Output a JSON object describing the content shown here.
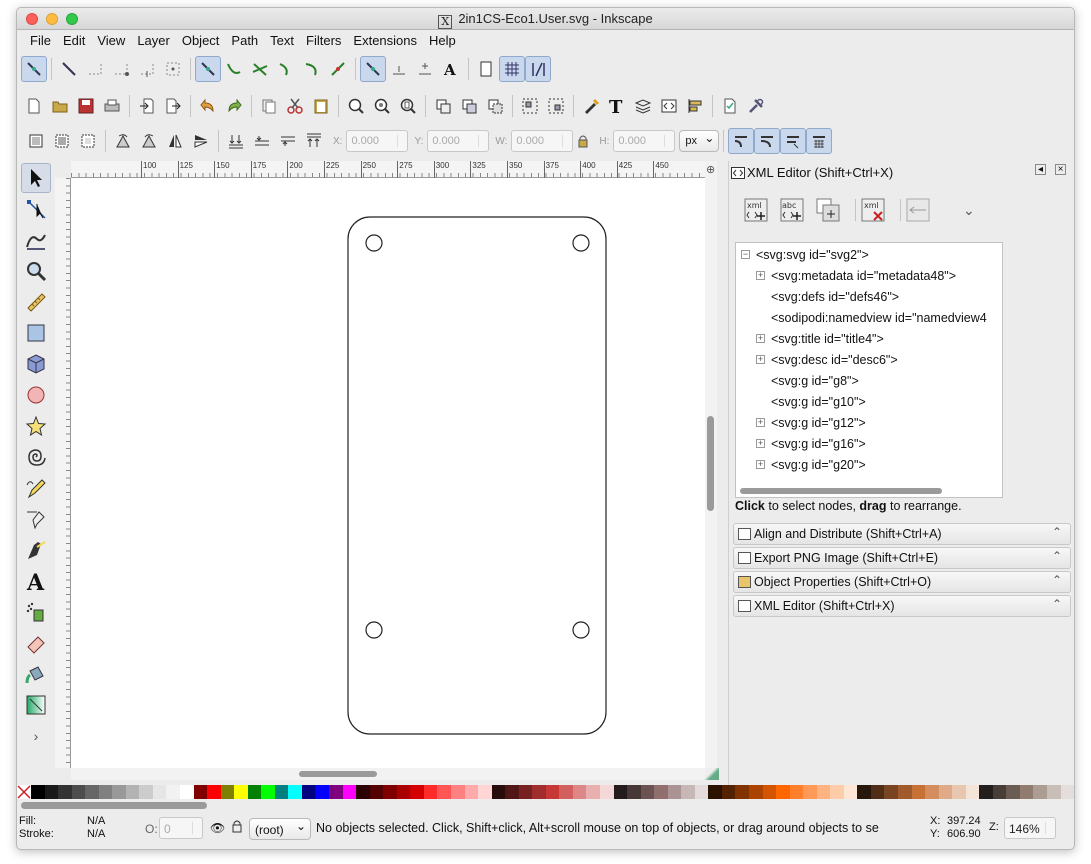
{
  "window": {
    "title": "2in1CS-Eco1.User.svg - Inkscape",
    "title_icon": "X"
  },
  "menubar": [
    "File",
    "Edit",
    "View",
    "Layer",
    "Object",
    "Path",
    "Text",
    "Filters",
    "Extensions",
    "Help"
  ],
  "select_toolbar": {
    "x_label": "X:",
    "x_value": "0.000",
    "y_label": "Y:",
    "y_value": "0.000",
    "w_label": "W:",
    "w_value": "0.000",
    "h_label": "H:",
    "h_value": "0.000",
    "unit": "px"
  },
  "ruler": {
    "top_ticks": [
      "100",
      "125",
      "150",
      "175",
      "200",
      "225",
      "250",
      "275",
      "300",
      "325",
      "350",
      "375",
      "400",
      "425",
      "450"
    ]
  },
  "xml_editor": {
    "title": "XML Editor (Shift+Ctrl+X)",
    "toolbar": {
      "new_element_icon": "xml",
      "new_text_icon": "abc",
      "delete_icon": "xml"
    },
    "nodes": [
      {
        "label": "<svg:svg id=\"svg2\">",
        "expander": "−",
        "level": 0
      },
      {
        "label": "<svg:metadata id=\"metadata48\">",
        "expander": "+",
        "level": 1
      },
      {
        "label": "<svg:defs id=\"defs46\">",
        "expander": "",
        "level": 1
      },
      {
        "label": "<sodipodi:namedview id=\"namedview4",
        "expander": "",
        "level": 1
      },
      {
        "label": "<svg:title id=\"title4\">",
        "expander": "+",
        "level": 1
      },
      {
        "label": "<svg:desc id=\"desc6\">",
        "expander": "+",
        "level": 1
      },
      {
        "label": "<svg:g id=\"g8\">",
        "expander": "",
        "level": 1
      },
      {
        "label": "<svg:g id=\"g10\">",
        "expander": "",
        "level": 1
      },
      {
        "label": "<svg:g id=\"g12\">",
        "expander": "+",
        "level": 1
      },
      {
        "label": "<svg:g id=\"g16\">",
        "expander": "+",
        "level": 1
      },
      {
        "label": "<svg:g id=\"g20\">",
        "expander": "+",
        "level": 1
      }
    ],
    "hint_bold1": "Click",
    "hint_text1": " to select nodes, ",
    "hint_bold2": "drag",
    "hint_text2": " to rearrange."
  },
  "dock_panels": [
    "Align and Distribute (Shift+Ctrl+A)",
    "Export PNG Image (Shift+Ctrl+E)",
    "Object Properties (Shift+Ctrl+O)",
    "XML Editor (Shift+Ctrl+X)"
  ],
  "palette": [
    "#000000",
    "#1a1a1a",
    "#333333",
    "#4d4d4d",
    "#666666",
    "#808080",
    "#999999",
    "#b3b3b3",
    "#cccccc",
    "#e6e6e6",
    "#f2f2f2",
    "#ffffff",
    "#800000",
    "#ff0000",
    "#808000",
    "#ffff00",
    "#008000",
    "#00ff00",
    "#008080",
    "#00ffff",
    "#000080",
    "#0000ff",
    "#800080",
    "#ff00ff",
    "#2b0000",
    "#550000",
    "#800000",
    "#aa0000",
    "#d40000",
    "#ff2a2a",
    "#ff5555",
    "#ff8080",
    "#ffaaaa",
    "#ffd5d5",
    "#280b0b",
    "#501616",
    "#782121",
    "#a02c2c",
    "#c83737",
    "#d35f5f",
    "#de8787",
    "#e9afaf",
    "#f4d7d7",
    "#241c1c",
    "#483737",
    "#6c5353",
    "#916f6f",
    "#ac9393",
    "#c8b7b7",
    "#e3dbdb",
    "#2b1100",
    "#552200",
    "#803300",
    "#aa4400",
    "#d45500",
    "#ff6600",
    "#ff7f2a",
    "#ff9955",
    "#ffb380",
    "#ffccaa",
    "#ffe6d5",
    "#28170b",
    "#502d16",
    "#784421",
    "#a05a2c",
    "#c87137",
    "#d38d5f",
    "#deaa87",
    "#e9c6af",
    "#f4e3d7",
    "#241f1c",
    "#483e37",
    "#6c5d53",
    "#917c6f",
    "#ac9d93",
    "#c8beb7",
    "#e3dedb"
  ],
  "status": {
    "fill_label": "Fill:",
    "fill_value": "N/A",
    "stroke_label": "Stroke:",
    "stroke_value": "N/A",
    "opacity_label": "O:",
    "opacity_value": "0",
    "layer": "(root)",
    "message": "No objects selected. Click, Shift+click, Alt+scroll mouse on top of objects, or drag around objects to se",
    "x_label": "X:",
    "x_value": "397.24",
    "y_label": "Y:",
    "y_value": "606.90",
    "zoom_label": "Z:",
    "zoom_value": "146%"
  }
}
